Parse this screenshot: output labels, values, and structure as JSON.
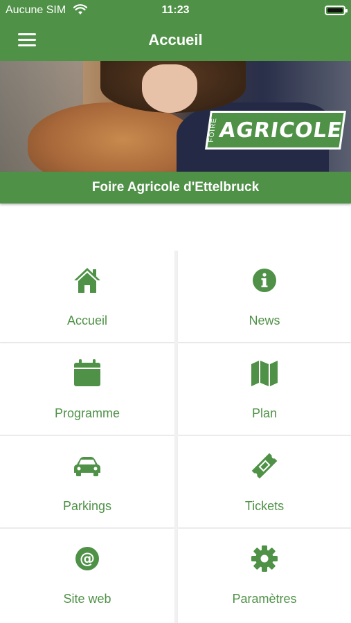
{
  "status_bar": {
    "carrier": "Aucune SIM",
    "time": "11:23"
  },
  "navbar": {
    "title": "Accueil"
  },
  "hero": {
    "logo_small": "FOIRE",
    "logo_big": "AGRICOLE"
  },
  "banner": {
    "title": "Foire Agricole d'Ettelbruck"
  },
  "menu": {
    "tiles": [
      {
        "label": "Accueil",
        "icon": "home-icon"
      },
      {
        "label": "News",
        "icon": "info-icon"
      },
      {
        "label": "Programme",
        "icon": "calendar-icon"
      },
      {
        "label": "Plan",
        "icon": "map-icon"
      },
      {
        "label": "Parkings",
        "icon": "car-icon"
      },
      {
        "label": "Tickets",
        "icon": "ticket-icon"
      },
      {
        "label": "Site web",
        "icon": "at-icon"
      },
      {
        "label": "Paramètres",
        "icon": "gear-icon"
      }
    ]
  },
  "colors": {
    "brand_green": "#4f9147",
    "tile_bg": "#ffffff",
    "grid_bg": "#f1f1f1"
  }
}
